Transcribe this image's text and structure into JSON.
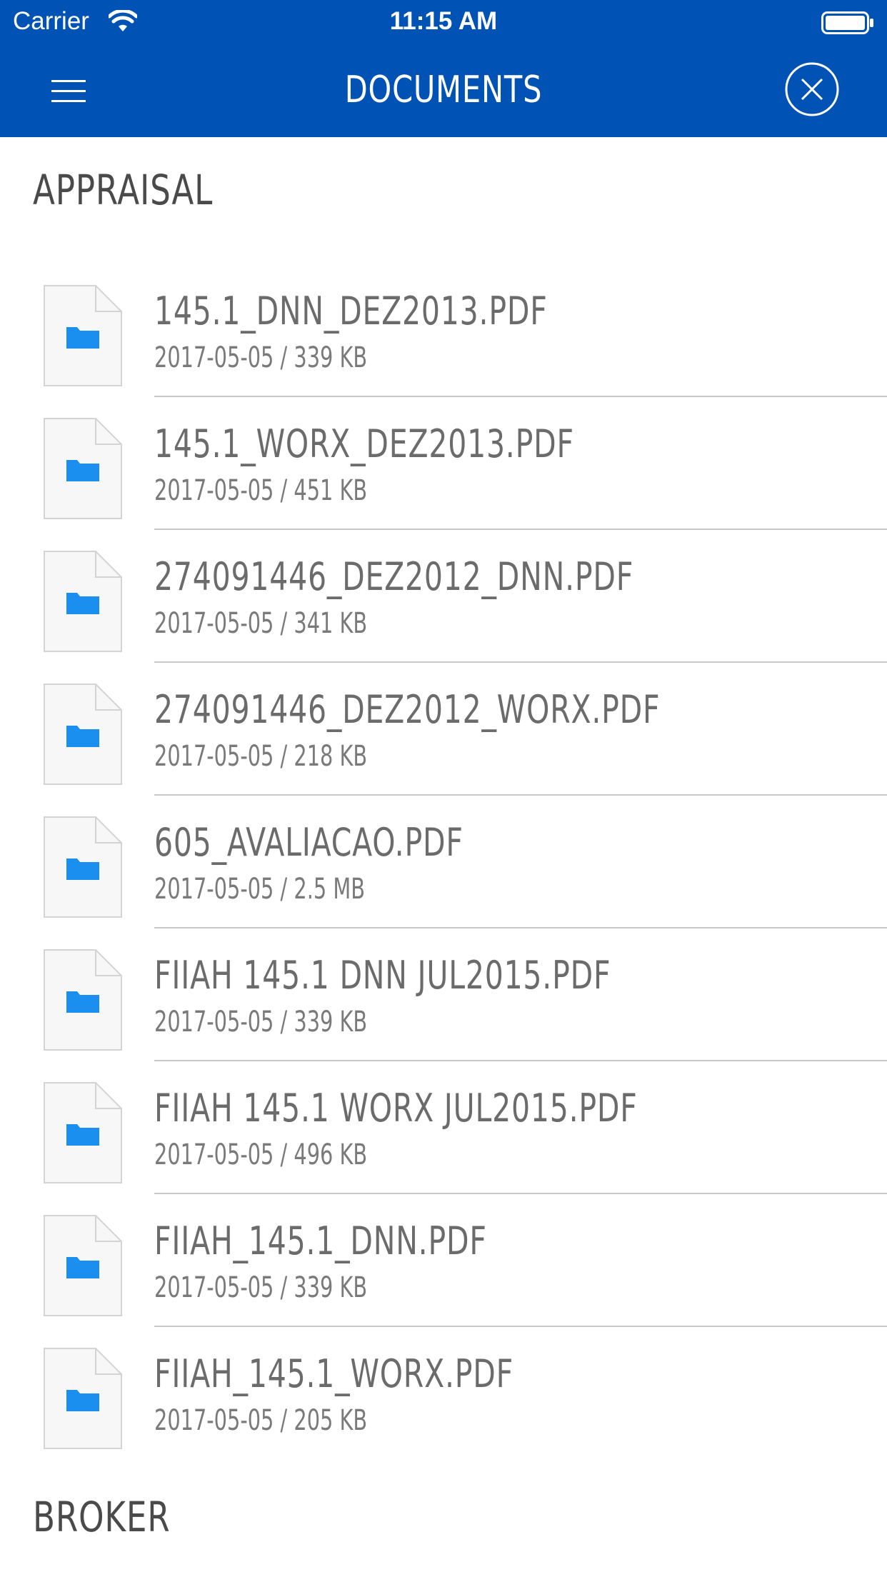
{
  "status_bar": {
    "carrier": "Carrier",
    "time": "11:15 AM"
  },
  "nav": {
    "title": "DOCUMENTS"
  },
  "sections": [
    {
      "title": "APPRAISAL",
      "files": [
        {
          "name": "145.1_DNN_DEZ2013.PDF",
          "meta": "2017-05-05 / 339 KB"
        },
        {
          "name": "145.1_WORX_DEZ2013.PDF",
          "meta": "2017-05-05 / 451 KB"
        },
        {
          "name": "274091446_DEZ2012_DNN.PDF",
          "meta": "2017-05-05 / 341 KB"
        },
        {
          "name": "274091446_DEZ2012_WORX.PDF",
          "meta": "2017-05-05 / 218 KB"
        },
        {
          "name": "605_AVALIACAO.PDF",
          "meta": "2017-05-05 / 2.5 MB"
        },
        {
          "name": "FIIAH 145.1 DNN JUL2015.PDF",
          "meta": "2017-05-05 / 339 KB"
        },
        {
          "name": "FIIAH 145.1 WORX JUL2015.PDF",
          "meta": "2017-05-05 / 496 KB"
        },
        {
          "name": "FIIAH_145.1_DNN.PDF",
          "meta": "2017-05-05 / 339 KB"
        },
        {
          "name": "FIIAH_145.1_WORX.PDF",
          "meta": "2017-05-05 / 205 KB"
        }
      ]
    },
    {
      "title": "BROKER",
      "files": []
    }
  ],
  "icons": {
    "menu": "hamburger-menu-icon",
    "close": "close-circle-icon",
    "file": "folder-document-icon"
  },
  "colors": {
    "nav_bg": "#0052b4",
    "folder": "#1a8ff0",
    "text_primary": "#6b6b6b",
    "section": "#4a4a4a"
  }
}
